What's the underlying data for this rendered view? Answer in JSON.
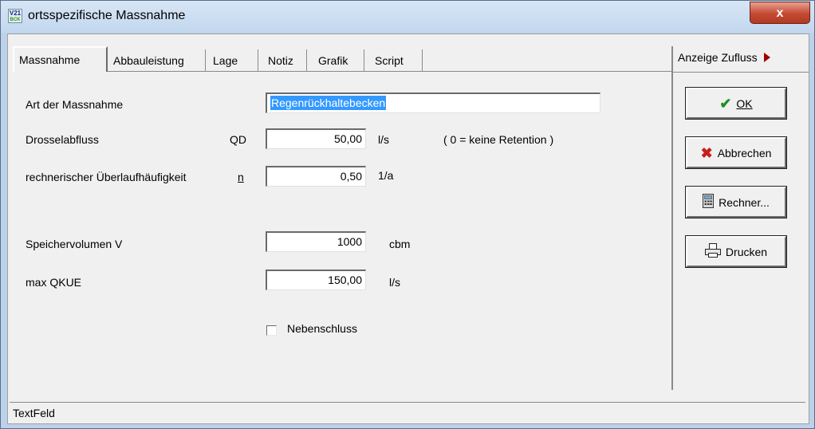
{
  "window": {
    "title": "ortsspezifische Massnahme",
    "icon_text_top": "V21",
    "icon_text_bottom": "BCK"
  },
  "close_glyph": "x",
  "tabs": [
    {
      "label": "Massnahme",
      "active": true
    },
    {
      "label": "Abbauleistung",
      "active": false
    },
    {
      "label": "Lage",
      "active": false
    },
    {
      "label": "Notiz",
      "active": false
    },
    {
      "label": "Grafik",
      "active": false
    },
    {
      "label": "Script",
      "active": false
    }
  ],
  "side": {
    "anzeige_label": "Anzeige Zufluss",
    "buttons": {
      "ok": {
        "label": "OK",
        "icon": "checkmark-icon"
      },
      "cancel": {
        "label": "Abbrechen",
        "icon": "x-icon"
      },
      "calc": {
        "label": "Rechner...",
        "icon": "calculator-icon"
      },
      "print": {
        "label": "Drucken",
        "icon": "printer-icon"
      }
    }
  },
  "form": {
    "art_label": "Art der Massnahme",
    "art_value": "Regenrückhaltebecken",
    "drossel_label": "Drosselabfluss",
    "drossel_symbol": "QD",
    "drossel_value": "50,00",
    "drossel_unit": "l/s",
    "drossel_hint": "( 0 = keine Retention )",
    "ueberlauf_label": "rechnerischer Überlaufhäufigkeit",
    "ueberlauf_symbol": "n",
    "ueberlauf_value": "0,50",
    "ueberlauf_unit": "1/a",
    "speicher_label": "Speichervolumen V",
    "speicher_value": "1000",
    "speicher_unit": "cbm",
    "qkue_label": "max QKUE",
    "qkue_value": "150,00",
    "qkue_unit": "l/s",
    "nebenschluss_label": "Nebenschluss",
    "nebenschluss_checked": false
  },
  "statusbar": {
    "text": "TextFeld"
  },
  "colors": {
    "selection": "#3399ff",
    "close_button": "#c44a33",
    "title_bar": "#c2d7ee"
  }
}
